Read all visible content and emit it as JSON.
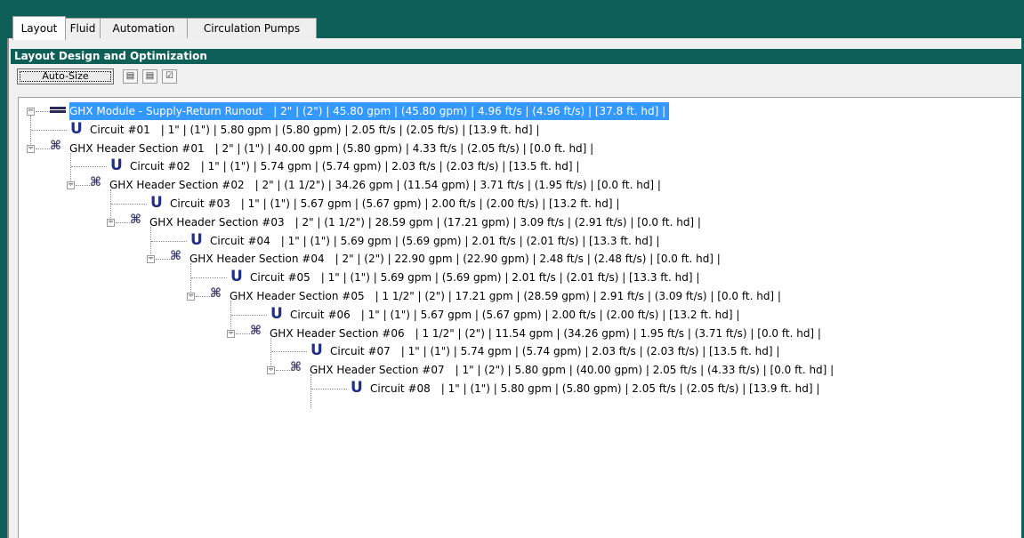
{
  "tabs": [
    "Layout",
    "Fluid",
    "Automation",
    "Circulation Pumps"
  ],
  "active_tab": "Layout",
  "section_title": "Layout Design and Optimization",
  "toolbar": {
    "auto_size_label": "Auto-Size",
    "icons": [
      "pipe-settings-icon",
      "report-icon",
      "checklist-icon"
    ]
  },
  "tree": {
    "root": {
      "label": "GHX Module - Supply-Return Runout",
      "details": "| 2\" | (2\") | 45.80 gpm | (45.80 gpm) | 4.96 ft/s | (4.96 ft/s) | [37.8 ft. hd] |",
      "selected": true
    },
    "nodes": [
      {
        "type": "circuit",
        "label": "Circuit #01",
        "details": "| 1\" | (1\") | 5.80 gpm | (5.80 gpm) | 2.05 ft/s | (2.05 ft/s) | [13.9 ft. hd] |"
      },
      {
        "type": "header",
        "label": "GHX Header Section #01",
        "details": "| 2\" | (1\") | 40.00 gpm | (5.80 gpm) | 4.33 ft/s | (2.05 ft/s) | [0.0 ft. hd] |"
      },
      {
        "type": "circuit",
        "label": "Circuit #02",
        "details": "| 1\" | (1\") | 5.74 gpm | (5.74 gpm) | 2.03 ft/s | (2.03 ft/s) | [13.5 ft. hd] |"
      },
      {
        "type": "header",
        "label": "GHX Header Section #02",
        "details": "| 2\" | (1 1/2\") | 34.26 gpm | (11.54 gpm) | 3.71 ft/s | (1.95 ft/s) | [0.0 ft. hd] |"
      },
      {
        "type": "circuit",
        "label": "Circuit #03",
        "details": "| 1\" | (1\") | 5.67 gpm | (5.67 gpm) | 2.00 ft/s | (2.00 ft/s) | [13.2 ft. hd] |"
      },
      {
        "type": "header",
        "label": "GHX Header Section #03",
        "details": "| 2\" | (1 1/2\") | 28.59 gpm | (17.21 gpm) | 3.09 ft/s | (2.91 ft/s) | [0.0 ft. hd] |"
      },
      {
        "type": "circuit",
        "label": "Circuit #04",
        "details": "| 1\" | (1\") | 5.69 gpm | (5.69 gpm) | 2.01 ft/s | (2.01 ft/s) | [13.3 ft. hd] |"
      },
      {
        "type": "header",
        "label": "GHX Header Section #04",
        "details": "| 2\" | (2\") | 22.90 gpm | (22.90 gpm) | 2.48 ft/s | (2.48 ft/s) | [0.0 ft. hd] |"
      },
      {
        "type": "circuit",
        "label": "Circuit #05",
        "details": "| 1\" | (1\") | 5.69 gpm | (5.69 gpm) | 2.01 ft/s | (2.01 ft/s) | [13.3 ft. hd] |"
      },
      {
        "type": "header",
        "label": "GHX Header Section #05",
        "details": "| 1 1/2\" | (2\") | 17.21 gpm | (28.59 gpm) | 2.91 ft/s | (3.09 ft/s) | [0.0 ft. hd] |"
      },
      {
        "type": "circuit",
        "label": "Circuit #06",
        "details": "| 1\" | (1\") | 5.67 gpm | (5.67 gpm) | 2.00 ft/s | (2.00 ft/s) | [13.2 ft. hd] |"
      },
      {
        "type": "header",
        "label": "GHX Header Section #06",
        "details": "| 1 1/2\" | (2\") | 11.54 gpm | (34.26 gpm) | 1.95 ft/s | (3.71 ft/s) | [0.0 ft. hd] |"
      },
      {
        "type": "circuit",
        "label": "Circuit #07",
        "details": "| 1\" | (1\") | 5.74 gpm | (5.74 gpm) | 2.03 ft/s | (2.03 ft/s) | [13.5 ft. hd] |"
      },
      {
        "type": "header",
        "label": "GHX Header Section #07",
        "details": "| 1\" | (2\") | 5.80 gpm | (40.00 gpm) | 2.05 ft/s | (4.33 ft/s) | [0.0 ft. hd] |"
      },
      {
        "type": "circuit",
        "label": "Circuit #08",
        "details": "| 1\" | (1\") | 5.80 gpm | (5.80 gpm) | 2.05 ft/s | (2.05 ft/s) | [13.9 ft. hd] |"
      }
    ]
  },
  "colors": {
    "frame": "#0d5f58",
    "selection": "#3399ff",
    "circuit_icon": "#1f2f8a"
  }
}
